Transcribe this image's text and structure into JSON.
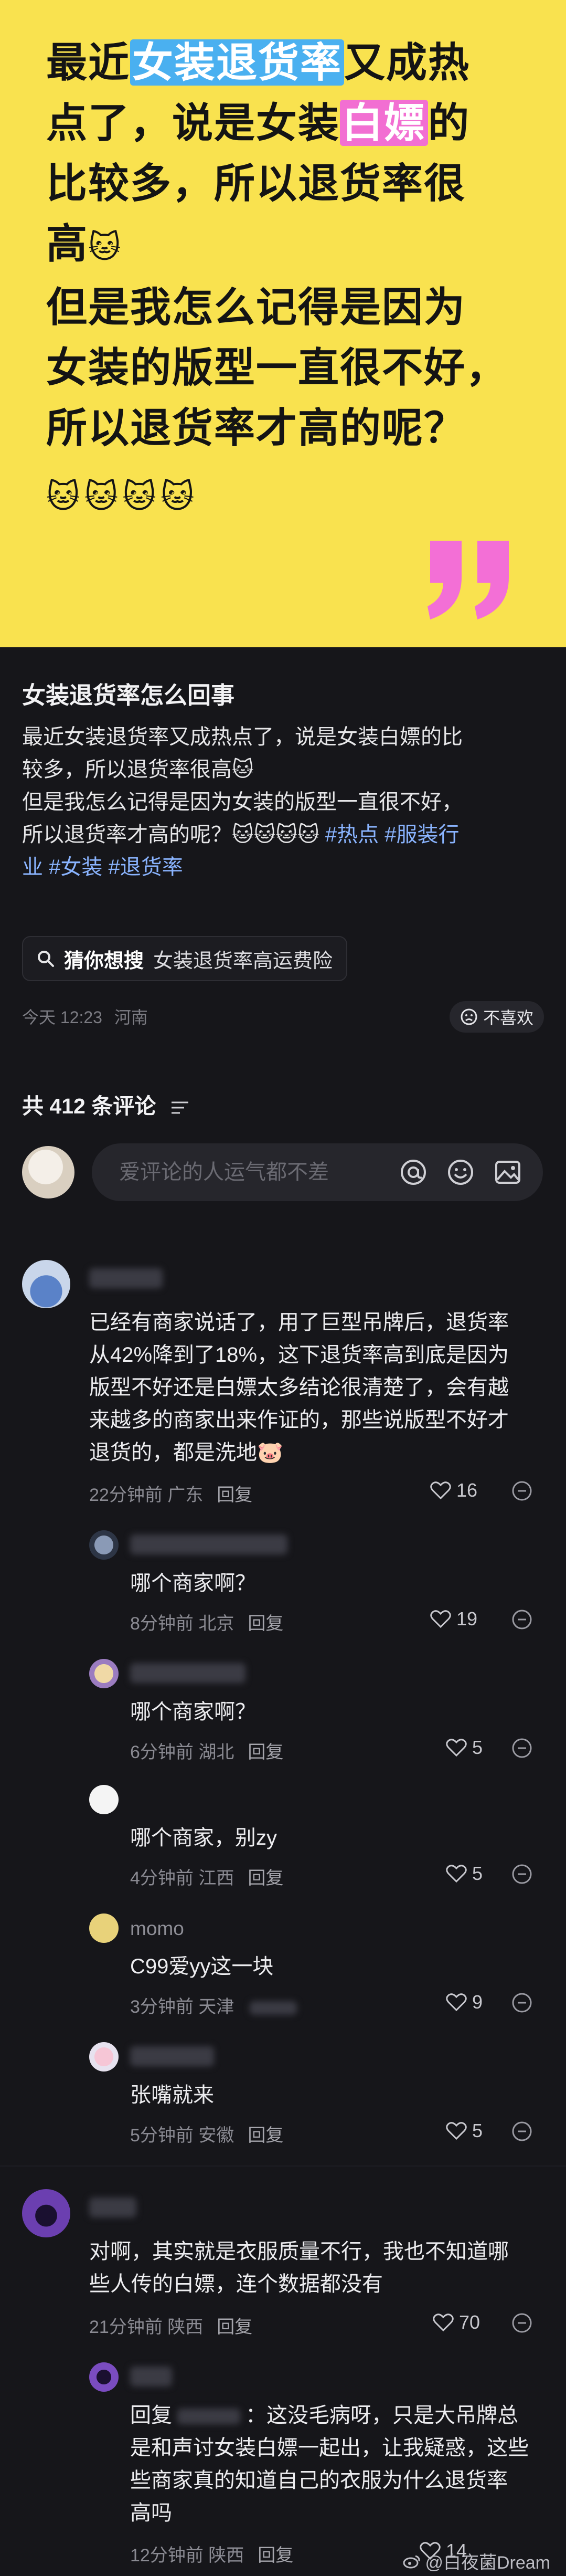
{
  "banner": {
    "line1_a": "最近",
    "line1_hl": "女装退货率",
    "line1_b": "又成热",
    "line2_a": "点了，说是女装",
    "line2_hl": "白嫖",
    "line2_b": "的",
    "line3": "比较多，所以退货率很",
    "line4": "高",
    "line5": "但是我怎么记得是因为",
    "line6": "女装的版型一直很不好，",
    "line7": "所以退货率才高的呢？",
    "cat_emoji": "🐱",
    "cats_row": "🐱🐱🐱🐱",
    "quote_color": "#f36fd6",
    "background_color": "#f9e24f"
  },
  "post": {
    "title": "女装退货率怎么回事",
    "body_line1": "最近女装退货率又成热点了，说是女装白嫖的比",
    "body_line2": "较多，所以退货率很高🐱",
    "body_line3": "但是我怎么记得是因为女装的版型一直很不好，",
    "body_line4": "所以退货率才高的呢？🐱🐱🐱🐱",
    "tag_hot": "#热点",
    "tag_industry": "#服装行",
    "tag_industry_cont": "业",
    "tag_women": "#女装",
    "tag_return": "#退货率",
    "guess_label": "猜你想搜",
    "guess_query": "女装退货率高运费险",
    "time": "今天 12:23",
    "location": "河南",
    "dislike_label": "不喜欢"
  },
  "comments_header": {
    "count_label": "共 412 条评论",
    "input_placeholder": "爱评论的人运气都不差"
  },
  "comments": [
    {
      "text_line1": "已经有商家说话了，用了巨型吊牌后，退货率",
      "text_line2": "从42%降到了18%，这下退货率高到底是因为",
      "text_line3": "版型不好还是白嫖太多结论很清楚了，会有越",
      "text_line4": "来越多的商家出来作证的，那些说版型不好才",
      "text_line5": "退货的，都是洗地🐷",
      "time": "22分钟前",
      "location": "广东",
      "reply_label": "回复",
      "likes": "16"
    },
    {
      "text": "哪个商家啊？",
      "time": "8分钟前",
      "location": "北京",
      "reply_label": "回复",
      "likes": "19"
    },
    {
      "text": "哪个商家啊？",
      "time": "6分钟前",
      "location": "湖北",
      "reply_label": "回复",
      "likes": "5"
    },
    {
      "text": "哪个商家，别zy",
      "time": "4分钟前",
      "location": "江西",
      "reply_label": "回复",
      "likes": "5"
    },
    {
      "username": "momo",
      "text": "C99爱yy这一块",
      "time": "3分钟前",
      "location": "天津",
      "likes": "9"
    },
    {
      "text": "张嘴就来",
      "time": "5分钟前",
      "location": "安徽",
      "reply_label": "回复",
      "likes": "5"
    },
    {
      "text_line1": "对啊，其实就是衣服质量不行，我也不知道哪",
      "text_line2": "些人传的白嫖，连个数据都没有",
      "time": "21分钟前",
      "location": "陕西",
      "reply_label": "回复",
      "likes": "70"
    },
    {
      "reply_prefix": "回复",
      "text_line1_tail": "：这没毛病呀，只是大吊牌总",
      "text_line2": "是和声讨女装白嫖一起出，让我疑惑，这些",
      "text_line3": "些商家真的知道自己的衣服为什么退货率",
      "text_line4": "高吗",
      "time": "12分钟前",
      "location": "陕西",
      "reply_label": "回复",
      "likes": "14"
    }
  ],
  "watermark": "@白夜菌Dream"
}
